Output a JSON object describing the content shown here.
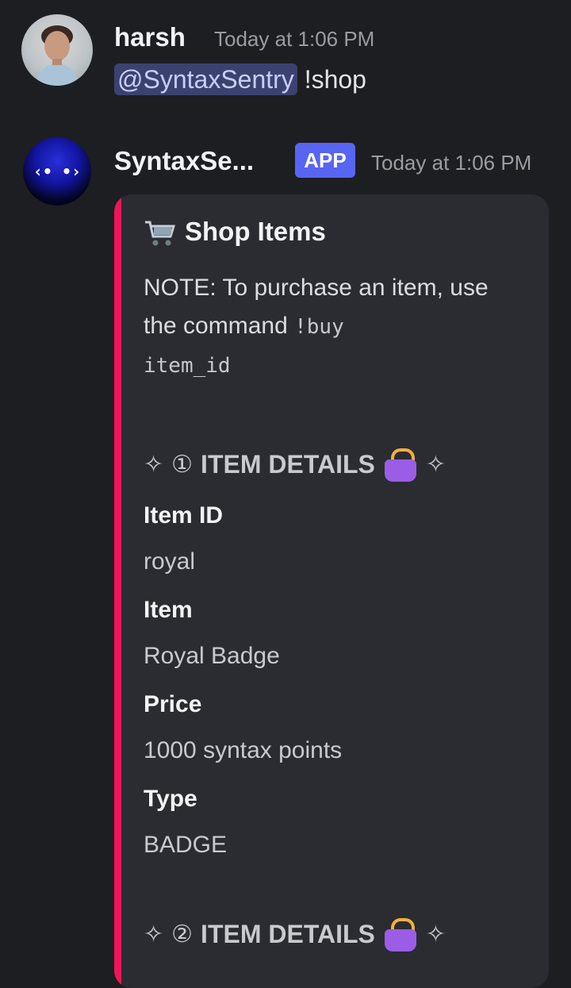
{
  "messages": [
    {
      "author": "harsh",
      "timestamp": "Today at 1:06 PM",
      "mention": "@SyntaxSentry",
      "text": " !shop"
    },
    {
      "author": "SyntaxSe...",
      "badge": "APP",
      "timestamp": "Today at 1:06 PM"
    }
  ],
  "embed": {
    "accent_color": "#f0145a",
    "title_icon": "shopping-cart-icon",
    "title": "Shop Items",
    "note_text": "NOTE: To purchase an item, use the command",
    "note_code_1": "!buy",
    "note_code_2": "item_id",
    "sections": [
      {
        "sparkle": "✧",
        "number": "①",
        "heading": "ITEM DETAILS",
        "icon": "handbag-icon",
        "fields": [
          {
            "name": "Item ID",
            "value": "royal"
          },
          {
            "name": "Item",
            "value": "Royal Badge"
          },
          {
            "name": "Price",
            "value": "1000 syntax points"
          },
          {
            "name": "Type",
            "value": "BADGE"
          }
        ]
      },
      {
        "sparkle": "✧",
        "number": "②",
        "heading": "ITEM DETAILS",
        "icon": "handbag-icon"
      }
    ]
  }
}
